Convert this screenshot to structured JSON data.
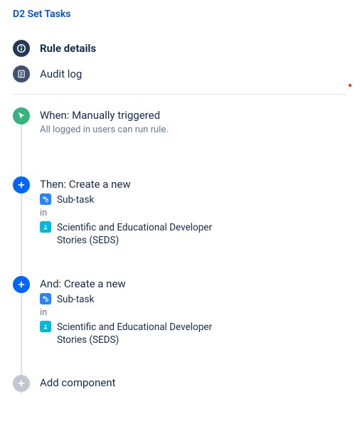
{
  "title": "D2 Set Tasks",
  "nav": {
    "rule_details": "Rule details",
    "audit_log": "Audit log"
  },
  "steps": [
    {
      "icon": "cursor",
      "icon_color": "green",
      "title": "When: Manually triggered",
      "subtitle": "All logged in users can run rule.",
      "blocks": []
    },
    {
      "icon": "plus",
      "icon_color": "blue",
      "title": "Then: Create a new",
      "subtitle": null,
      "blocks": [
        {
          "kind": "subtask",
          "label": "Sub-task"
        },
        {
          "kind": "in",
          "label": "in"
        },
        {
          "kind": "project",
          "label": "Scientific and Educational Developer Stories (SEDS)"
        }
      ]
    },
    {
      "icon": "plus",
      "icon_color": "blue",
      "title": "And: Create a new",
      "subtitle": null,
      "blocks": [
        {
          "kind": "subtask",
          "label": "Sub-task"
        },
        {
          "kind": "in",
          "label": "in"
        },
        {
          "kind": "project",
          "label": "Scientific and Educational Developer Stories (SEDS)"
        }
      ]
    }
  ],
  "add_component": "Add component"
}
